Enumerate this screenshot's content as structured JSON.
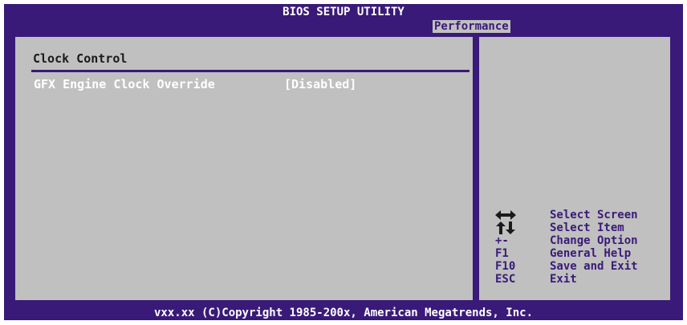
{
  "header": {
    "title": "BIOS SETUP UTILITY",
    "active_tab": "Performance"
  },
  "main": {
    "section_title": "Clock Control",
    "settings": [
      {
        "label": "GFX Engine Clock Override",
        "value": "[Disabled]"
      }
    ]
  },
  "help": {
    "items": [
      {
        "key": "",
        "icon": "left-right-arrows-icon",
        "desc": "Select Screen"
      },
      {
        "key": "",
        "icon": "up-down-arrows-icon",
        "desc": "Select Item"
      },
      {
        "key": "+-",
        "desc": "Change Option"
      },
      {
        "key": "F1",
        "desc": "General Help"
      },
      {
        "key": "F10",
        "desc": "Save and Exit"
      },
      {
        "key": "ESC",
        "desc": "Exit"
      }
    ]
  },
  "footer": {
    "copyright": "vxx.xx (C)Copyright 1985-200x, American Megatrends, Inc."
  },
  "colors": {
    "frame": "#3a1a78",
    "panel": "#c0c0c0",
    "highlight_text": "#ffffff"
  }
}
